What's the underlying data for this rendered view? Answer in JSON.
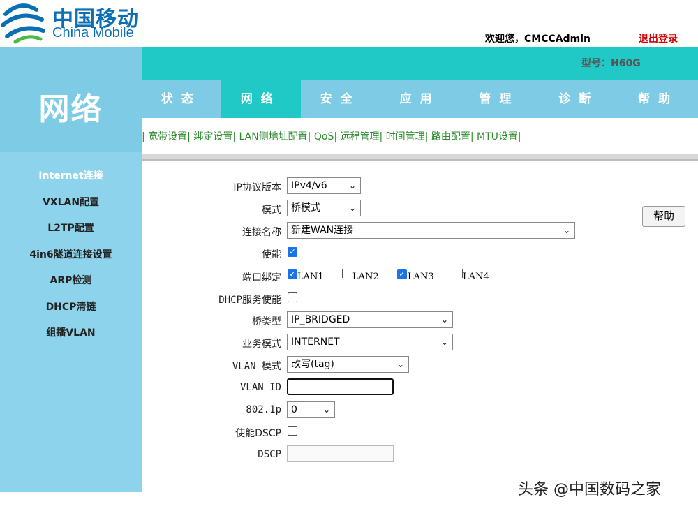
{
  "header": {
    "logo_cn": "中国移动",
    "logo_en": "China Mobile",
    "welcome": "欢迎您，CMCCAdmin",
    "logout": "退出登录",
    "model": "型号：H60G"
  },
  "nav": {
    "tabs": [
      {
        "label": "状态",
        "active": false
      },
      {
        "label": "网络",
        "active": true
      },
      {
        "label": "安全",
        "active": false
      },
      {
        "label": "应用",
        "active": false
      },
      {
        "label": "管理",
        "active": false
      },
      {
        "label": "诊断",
        "active": false
      },
      {
        "label": "帮助",
        "active": false
      }
    ]
  },
  "sidebar": {
    "title": "网络",
    "items": [
      {
        "label": "Internet连接",
        "active": true
      },
      {
        "label": "VXLAN配置",
        "active": false
      },
      {
        "label": "L2TP配置",
        "active": false
      },
      {
        "label": "4in6隧道连接设置",
        "active": false
      },
      {
        "label": "ARP检测",
        "active": false
      },
      {
        "label": "DHCP清链",
        "active": false
      },
      {
        "label": "组播VLAN",
        "active": false
      }
    ]
  },
  "subnav": {
    "items": [
      "宽带设置",
      "绑定设置",
      "LAN侧地址配置",
      "QoS",
      "远程管理",
      "时间管理",
      "路由配置",
      "MTU设置"
    ]
  },
  "form": {
    "ip_version": {
      "label": "IP协议版本",
      "value": "IPv4/v6"
    },
    "mode": {
      "label": "模式",
      "value": "桥模式"
    },
    "conn_name": {
      "label": "连接名称",
      "value": "新建WAN连接"
    },
    "enable": {
      "label": "使能",
      "checked": true
    },
    "port_binding": {
      "label": "端口绑定",
      "ports": [
        {
          "label": "LAN1",
          "checked": true
        },
        {
          "label": "LAN2",
          "checked": false
        },
        {
          "label": "LAN3",
          "checked": true
        },
        {
          "label": "LAN4",
          "checked": false
        }
      ]
    },
    "dhcp_enable": {
      "label": "DHCP服务使能",
      "checked": false
    },
    "bridge_type": {
      "label": "桥类型",
      "value": "IP_BRIDGED"
    },
    "service_mode": {
      "label": "业务模式",
      "value": "INTERNET"
    },
    "vlan_mode": {
      "label": "VLAN 模式",
      "value": "改写(tag)"
    },
    "vlan_id": {
      "label": "VLAN ID",
      "value": ""
    },
    "p8021": {
      "label": "802.1p",
      "value": "0"
    },
    "dscp_enable": {
      "label": "使能DSCP",
      "checked": false
    },
    "dscp": {
      "label": "DSCP",
      "value": ""
    },
    "help_button": "帮助"
  },
  "watermark": "头条 @中国数码之家",
  "colors": {
    "teal": "#21c9c6",
    "light_blue": "#7ecbe6",
    "sidebar": "#8ed3ec",
    "logout_red": "#cc0000",
    "subnav_green": "#2e8b2e",
    "brand_blue": "#0a6fb3"
  }
}
